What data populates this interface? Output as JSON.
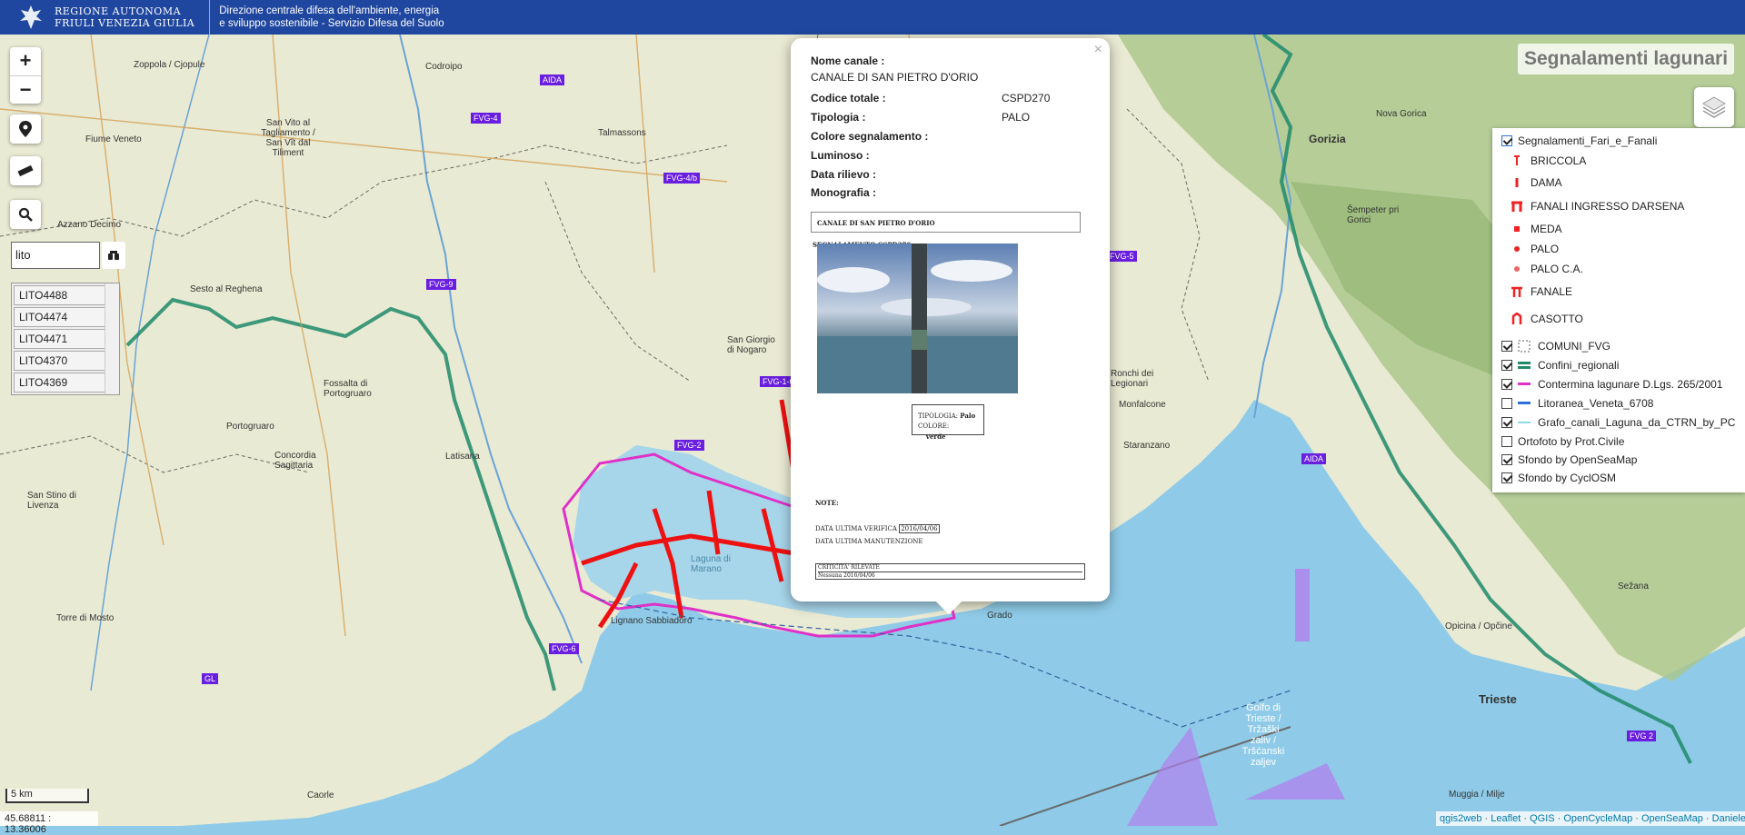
{
  "header": {
    "org_line1": "REGIONE AUTONOMA",
    "org_line2": "FRIULI VENEZIA GIULIA",
    "dept_line1": "Direzione centrale difesa dell'ambiente, energia",
    "dept_line2": "e sviluppo sostenibile - Servizio Difesa del Suolo"
  },
  "map_title": "Segnalamenti lagunari",
  "zoom": {
    "in": "+",
    "out": "−"
  },
  "search": {
    "value": "lito",
    "results": [
      "LITO4488",
      "LITO4474",
      "LITO4471",
      "LITO4370",
      "LITO4369"
    ]
  },
  "popup": {
    "close": "×",
    "nome_canale_label": "Nome canale :",
    "nome_canale_value": "CANALE DI SAN PIETRO D'ORIO",
    "rows": [
      {
        "key": "Codice totale :",
        "value": "CSPD270"
      },
      {
        "key": "Tipologia :",
        "value": "PALO"
      },
      {
        "key": "Colore segnalamento :",
        "value": ""
      },
      {
        "key": "Luminoso :",
        "value": ""
      },
      {
        "key": "Data rilievo :",
        "value": ""
      },
      {
        "key": "Monografia :",
        "value": ""
      }
    ],
    "monografia": {
      "title": "CANALE DI SAN PIETRO D'ORIO",
      "subtitle": "SEGNALAMENTO CSPD270",
      "tipologia_label": "TIPOLOGIA:",
      "tipologia_value": "Palo",
      "colore_label": "COLORE:",
      "colore_value": "verde",
      "note_label": "NOTE:",
      "data_verifica_label": "DATA ULTIMA VERIFICA",
      "data_verifica_value": "2016/04/06",
      "data_manutenzione_label": "DATA ULTIMA MANUTENZIONE",
      "criticita_label": "CRITICITA' RILEVATE",
      "criticita_row": "Nessuna     2016/04/06"
    }
  },
  "legend": {
    "group": "Segnalamenti_Fari_e_Fanali",
    "symbols": [
      "BRICCOLA",
      "DAMA",
      "FANALI INGRESSO DARSENA",
      "MEDA",
      "PALO",
      "PALO C.A.",
      "FANALE",
      "CASOTTO"
    ],
    "layers": [
      {
        "label": "COMUNI_FVG",
        "checked": true
      },
      {
        "label": "Confini_regionali",
        "checked": true
      },
      {
        "label": "Conterminа lagunare D.Lgs. 265/2001",
        "checked": true
      },
      {
        "label": "Litoranea_Veneta_6708",
        "checked": false
      },
      {
        "label": "Grafo_canali_Laguna_da_CTRN_by_PC",
        "checked": true
      },
      {
        "label": "Ortofoto by Prot.Civile",
        "checked": false
      },
      {
        "label": "Sfondo by OpenSeaMap",
        "checked": true
      },
      {
        "label": "Sfondo by CyclOSM",
        "checked": true
      }
    ]
  },
  "places": {
    "zoppola": "Zoppola / Cjopule",
    "codroipo": "Codroipo",
    "sanvito": "San Vito al Tagliamento / San Vît dal Tiliment",
    "fiume": "Fiume Veneto",
    "talmassons": "Talmassons",
    "azzano": "Azzano Decimo",
    "sesto": "Sesto al Reghena",
    "fossalta": "Fossalta di Portogruaro",
    "portogruaro": "Portogruaro",
    "concordia": "Concordia Sagittaria",
    "santostino": "San Stino di Livenza",
    "torre": "Torre di Mosto",
    "caorle": "Caorle",
    "latisana": "Latisana",
    "sangiorgio": "San Giorgio di Nogaro",
    "gorizia": "Gorizia",
    "novagorica": "Nova Gorica",
    "sempeter": "Šempeter pri Gorici",
    "ronchi": "Ronchi dei Legionari",
    "monfalcone": "Monfalcone",
    "staranzano": "Staranzano",
    "opicina": "Opicina / Opčine",
    "trieste": "Trieste",
    "muggia": "Muggia / Milje",
    "sezana": "Sežana",
    "golfo": "Golfo di Trieste / Tržaški zaliv / Tršćanski zaljev",
    "laguna": "Laguna di Marano",
    "lignano": "Lignano Sabbiadoro",
    "grado": "Grado"
  },
  "route_badges": [
    "AIDA",
    "FVG-4",
    "FVG-4/b",
    "FVG-9",
    "FVG-5",
    "FVG-2",
    "FVG-6",
    "FVG 2",
    "GL",
    "FVG-1-6",
    "AIDA"
  ],
  "scale": "5 km",
  "coords": "45.68811 : 13.36006",
  "attribution": [
    "qgis2web",
    "Leaflet",
    "QGIS",
    "OpenCycleMap",
    "OpenSeaMap",
    "Daniele"
  ]
}
